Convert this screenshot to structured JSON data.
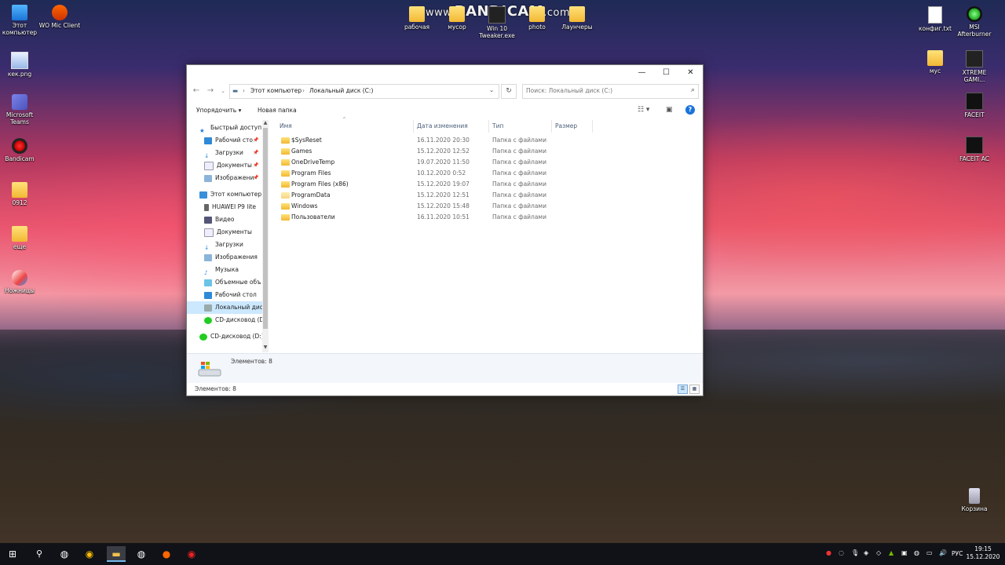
{
  "watermark": {
    "prefix": "www.",
    "brand": "BANDICAM",
    "suffix": ".com"
  },
  "desktop_icons_left": [
    {
      "label": "Этот компьютер",
      "icon": "computer-icon"
    },
    {
      "label": "WO Mic Client",
      "icon": "mic-icon"
    },
    {
      "label": "кек.png",
      "icon": "image-icon"
    },
    {
      "label": "Microsoft Teams",
      "icon": "teams-icon"
    },
    {
      "label": "Bandicam",
      "icon": "bandicam-icon"
    },
    {
      "label": "0912",
      "icon": "document-icon"
    },
    {
      "label": "еще",
      "icon": "folder-icon"
    },
    {
      "label": "Ножницы",
      "icon": "scissors-icon"
    }
  ],
  "desktop_icons_top": [
    {
      "label": "рабочая",
      "icon": "folder-icon"
    },
    {
      "label": "мусор",
      "icon": "folder-icon"
    },
    {
      "label": "Win 10 Tweaker.exe",
      "icon": "app-icon"
    },
    {
      "label": "photo",
      "icon": "folder-icon"
    },
    {
      "label": "Лаунчеры",
      "icon": "folder-icon"
    }
  ],
  "desktop_icons_right": [
    {
      "label": "конфиг.txt",
      "icon": "text-file-icon"
    },
    {
      "label": "MSI Afterburner",
      "icon": "msi-icon"
    },
    {
      "label": "мус",
      "icon": "folder-icon"
    },
    {
      "label": "XTREME GAMI...",
      "icon": "xtreme-icon"
    },
    {
      "label": "FACEIT",
      "icon": "faceit-icon"
    },
    {
      "label": "FACEIT AC",
      "icon": "faceit-ac-icon"
    },
    {
      "label": "Корзина",
      "icon": "recycle-bin-icon"
    }
  ],
  "window": {
    "controls": {
      "minimize": "—",
      "maximize": "☐",
      "close": "✕"
    },
    "breadcrumb": [
      "Этот компьютер",
      "Локальный диск (C:)"
    ],
    "search_placeholder": "Поиск: Локальный диск (C:)",
    "toolbar": {
      "organize": "Упорядочить ▾",
      "new_folder": "Новая папка"
    },
    "nav_pane": [
      {
        "label": "Быстрый доступ",
        "icon": "star-icon",
        "indent": 0,
        "pinned": false,
        "selected": false
      },
      {
        "label": "Рабочий сто",
        "icon": "desktop-icon",
        "indent": 1,
        "pinned": true,
        "selected": false
      },
      {
        "label": "Загрузки",
        "icon": "download-icon",
        "indent": 1,
        "pinned": true,
        "selected": false
      },
      {
        "label": "Документы",
        "icon": "documents-icon",
        "indent": 1,
        "pinned": true,
        "selected": false
      },
      {
        "label": "Изображени",
        "icon": "pictures-icon",
        "indent": 1,
        "pinned": true,
        "selected": false
      },
      {
        "label": "Этот компьютер",
        "icon": "computer-icon",
        "indent": 0,
        "pinned": false,
        "selected": false
      },
      {
        "label": "HUAWEI P9 lite",
        "icon": "phone-icon",
        "indent": 1,
        "pinned": false,
        "selected": false
      },
      {
        "label": "Видео",
        "icon": "video-icon",
        "indent": 1,
        "pinned": false,
        "selected": false
      },
      {
        "label": "Документы",
        "icon": "documents-icon",
        "indent": 1,
        "pinned": false,
        "selected": false
      },
      {
        "label": "Загрузки",
        "icon": "download-icon",
        "indent": 1,
        "pinned": false,
        "selected": false
      },
      {
        "label": "Изображения",
        "icon": "pictures-icon",
        "indent": 1,
        "pinned": false,
        "selected": false
      },
      {
        "label": "Музыка",
        "icon": "music-icon",
        "indent": 1,
        "pinned": false,
        "selected": false
      },
      {
        "label": "Объемные объ",
        "icon": "3d-objects-icon",
        "indent": 1,
        "pinned": false,
        "selected": false
      },
      {
        "label": "Рабочий стол",
        "icon": "desktop-icon",
        "indent": 1,
        "pinned": false,
        "selected": false
      },
      {
        "label": "Локальный дис",
        "icon": "drive-icon",
        "indent": 1,
        "pinned": false,
        "selected": true
      },
      {
        "label": "CD-дисковод (D",
        "icon": "cd-drive-icon",
        "indent": 1,
        "pinned": false,
        "selected": false
      },
      {
        "label": "CD-дисковод (D:)",
        "icon": "cd-drive-icon",
        "indent": 0,
        "pinned": false,
        "selected": false
      }
    ],
    "columns": {
      "name": "Имя",
      "date": "Дата изменения",
      "type": "Тип",
      "size": "Размер"
    },
    "files": [
      {
        "name": "$SysReset",
        "date": "16.11.2020 20:30",
        "type": "Папка с файлами"
      },
      {
        "name": "Games",
        "date": "15.12.2020 12:52",
        "type": "Папка с файлами"
      },
      {
        "name": "OneDriveTemp",
        "date": "19.07.2020 11:50",
        "type": "Папка с файлами"
      },
      {
        "name": "Program Files",
        "date": "10.12.2020 0:52",
        "type": "Папка с файлами"
      },
      {
        "name": "Program Files (x86)",
        "date": "15.12.2020 19:07",
        "type": "Папка с файлами"
      },
      {
        "name": "ProgramData",
        "date": "15.12.2020 12:51",
        "type": "Папка с файлами"
      },
      {
        "name": "Windows",
        "date": "15.12.2020 15:48",
        "type": "Папка с файлами"
      },
      {
        "name": "Пользователи",
        "date": "16.11.2020 10:51",
        "type": "Папка с файлами"
      }
    ],
    "details_count": "Элементов: 8",
    "status": "Элементов: 8"
  },
  "taskbar": {
    "apps": [
      "start-icon",
      "search-icon",
      "steam-icon",
      "chrome-icon",
      "explorer-icon",
      "steam-icon",
      "wo-mic-icon",
      "bandicam-icon"
    ],
    "lang": "РУС",
    "time": "19:15",
    "date": "15.12.2020"
  }
}
